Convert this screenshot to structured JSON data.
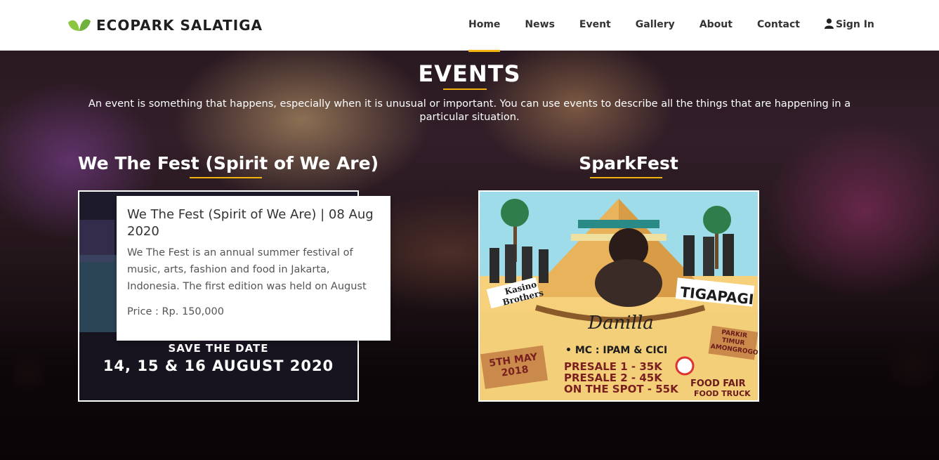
{
  "navbar": {
    "brand": "ECOPARK SALATIGA",
    "items": [
      {
        "label": "Home",
        "active": true
      },
      {
        "label": "News"
      },
      {
        "label": "Event"
      },
      {
        "label": "Gallery"
      },
      {
        "label": "About"
      },
      {
        "label": "Contact"
      }
    ],
    "signin_label": "Sign In"
  },
  "section": {
    "title": "EVENTS",
    "description": "An event is something that happens, especially when it is unusual or important. You can use events to describe all the things that are happening in a particular situation."
  },
  "events": [
    {
      "title": "We The Fest (Spirit of We Are)",
      "poster_text_1": "SAVE THE DATE",
      "poster_text_2": "14, 15 & 16 AUGUST 2020",
      "popup": {
        "title": "We The Fest (Spirit of We Are) | 08 Aug 2020",
        "description": "We The Fest is an annual summer festival of music, arts, fashion and food in Jakarta, Indonesia. The first edition was held on August",
        "price": "Price : Rp. 150,000"
      }
    },
    {
      "title": "SparkFest",
      "poster": {
        "band_left": "Kasino Brothers",
        "band_right": "TIGAPAGI",
        "headliner": "Danilla",
        "date": "5TH MAY 2018",
        "mc": "• MC : IPAM & CICI",
        "presale1": "PRESALE 1 - 35K",
        "presale2": "PRESALE 2 - 45K",
        "spot": "ON THE SPOT - 55K",
        "venue": "PARKIR TIMUR AMONGROGO",
        "food1": "FOOD FAIR",
        "food2": "FOOD TRUCK"
      }
    }
  ],
  "colors": {
    "accent": "#f2b20d",
    "leaf": "#8cc63f"
  }
}
